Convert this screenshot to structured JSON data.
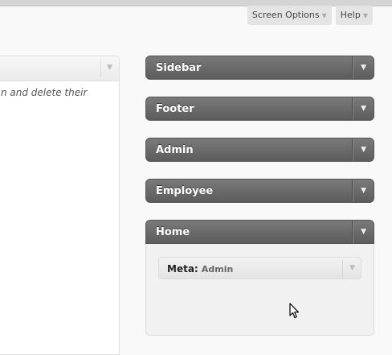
{
  "screen_meta": {
    "screen_options": "Screen Options",
    "help": "Help",
    "arrow": "▼"
  },
  "left_panel": {
    "description": "n and delete their",
    "toggle": "▼"
  },
  "widget_areas": [
    {
      "title": "Sidebar",
      "toggle": "▼"
    },
    {
      "title": "Footer",
      "toggle": "▼"
    },
    {
      "title": "Admin",
      "toggle": "▼"
    },
    {
      "title": "Employee",
      "toggle": "▼"
    },
    {
      "title": "Home",
      "toggle": "▼"
    }
  ],
  "home_widget": {
    "name": "Meta",
    "separator": ": ",
    "sub": "Admin",
    "toggle": "▼"
  },
  "colors": {
    "widget_header": "#6b6b6b",
    "background": "#f9f9f9"
  },
  "icons": [
    "chevron-down-icon",
    "mouse-cursor-icon"
  ]
}
